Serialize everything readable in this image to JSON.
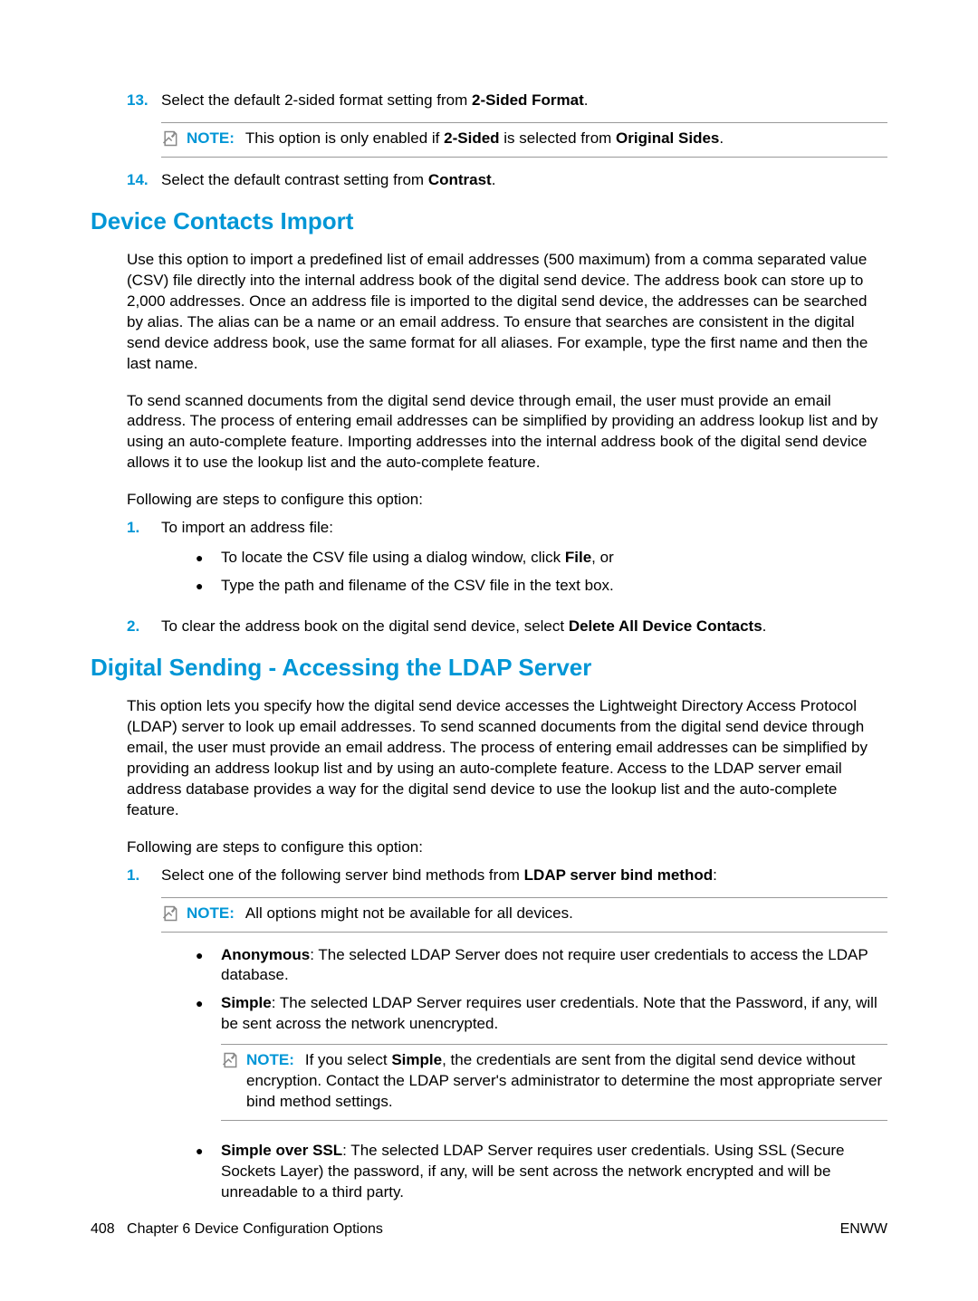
{
  "steps_top": [
    {
      "num": "13.",
      "text_before": "Select the default 2-sided format setting from ",
      "bold1": "2-Sided Format",
      "text_after": "."
    },
    {
      "num": "14.",
      "text_before": "Select the default contrast setting from ",
      "bold1": "Contrast",
      "text_after": "."
    }
  ],
  "note1": {
    "label": "NOTE:",
    "text_before": "This option is only enabled if ",
    "bold1": "2-Sided",
    "text_mid": " is selected from ",
    "bold2": "Original Sides",
    "text_after": "."
  },
  "section1": {
    "heading": "Device Contacts Import",
    "para1": "Use this option to import a predefined list of email addresses (500 maximum) from a comma separated value (CSV) file directly into the internal address book of the digital send device. The address book can store up to 2,000 addresses. Once an address file is imported to the digital send device, the addresses can be searched by alias. The alias can be a name or an email address. To ensure that searches are consistent in the digital send device address book, use the same format for all aliases. For example, type the first name and then the last name.",
    "para2": "To send scanned documents from the digital send device through email, the user must provide an email address. The process of entering email addresses can be simplified by providing an address lookup list and by using an auto-complete feature. Importing addresses into the internal address book of the digital send device allows it to use the lookup list and the auto-complete feature.",
    "para3": "Following are steps to configure this option:",
    "step1": {
      "num": "1.",
      "text": "To import an address file:",
      "sub1_before": "To locate the CSV file using a dialog window, click ",
      "sub1_bold": "File",
      "sub1_after": ", or",
      "sub2": "Type the path and filename of the CSV file in the text box."
    },
    "step2": {
      "num": "2.",
      "text_before": "To clear the address book on the digital send device, select ",
      "bold": "Delete All Device Contacts",
      "text_after": "."
    }
  },
  "section2": {
    "heading": "Digital Sending - Accessing the LDAP Server",
    "para1": "This option lets you specify how the digital send device accesses the Lightweight Directory Access Protocol (LDAP) server to look up email addresses. To send scanned documents from the digital send device through email, the user must provide an email address. The process of entering email addresses can be simplified by providing an address lookup list and by using an auto-complete feature. Access to the LDAP server email address database provides a way for the digital send device to use the lookup list and the auto-complete feature.",
    "para2": "Following are steps to configure this option:",
    "step1": {
      "num": "1.",
      "text_before": "Select one of the following server bind methods from ",
      "bold": "LDAP server bind method",
      "text_after": ":"
    },
    "note2": {
      "label": "NOTE:",
      "text": "All options might not be available for all devices."
    },
    "bullets": {
      "b1_bold": "Anonymous",
      "b1_text": ": The selected LDAP Server does not require user credentials to access the LDAP database.",
      "b2_bold": "Simple",
      "b2_text": ": The selected LDAP Server requires user credentials. Note that the Password, if any, will be sent across the network unencrypted.",
      "b3_bold": "Simple over SSL",
      "b3_text": ": The selected LDAP Server requires user credentials. Using SSL (Secure Sockets Layer) the password, if any, will be sent across the network encrypted and will be unreadable to a third party."
    },
    "note3": {
      "label": "NOTE:",
      "text_before": "If you select ",
      "bold": "Simple",
      "text_after": ", the credentials are sent from the digital send device without encryption. Contact the LDAP server's administrator to determine the most appropriate server bind method settings."
    }
  },
  "footer": {
    "left_page": "408",
    "left_chapter": "Chapter 6   Device Configuration Options",
    "right": "ENWW"
  }
}
